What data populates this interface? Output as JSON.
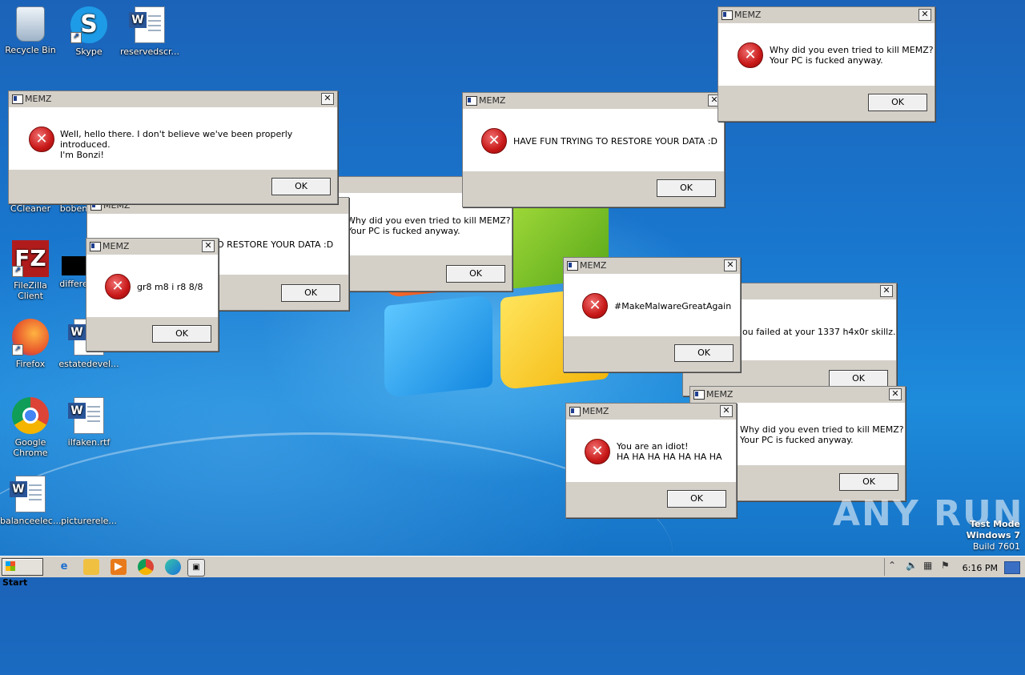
{
  "desktop_icons": [
    {
      "label": "Recycle Bin",
      "icon": "recycle-bin-icon"
    },
    {
      "label": "Skype",
      "icon": "skype-icon"
    },
    {
      "label": "reservedscr...",
      "icon": "word-document-icon"
    },
    {
      "label": "CCleaner",
      "icon": "ccleaner-icon"
    },
    {
      "label": "boben",
      "icon": "word-document-icon"
    },
    {
      "label": "FileZilla Client",
      "icon": "filezilla-icon"
    },
    {
      "label": "differe",
      "icon": "black-file-icon"
    },
    {
      "label": "Firefox",
      "icon": "firefox-icon"
    },
    {
      "label": "estatedevel...",
      "icon": "word-document-icon"
    },
    {
      "label": "Google Chrome",
      "icon": "chrome-icon"
    },
    {
      "label": "ilfaken.rtf",
      "icon": "word-document-icon"
    },
    {
      "label": "balanceelec...",
      "icon": "word-document-icon"
    },
    {
      "label": "picturerele...",
      "icon": "file-icon"
    }
  ],
  "dialogs": [
    {
      "title": "MEMZ",
      "message": "Why did you even tried to kill MEMZ?\nYour PC is fucked anyway.",
      "button": "OK"
    },
    {
      "title": "MEMZ",
      "message": "HAVE FUN TRYING TO RESTORE YOUR DATA :D",
      "button": "OK"
    },
    {
      "title": "MEMZ",
      "message": "Well, hello there. I don't believe we've been properly introduced.\nI'm Bonzi!",
      "button": "OK"
    },
    {
      "title": "",
      "message": "Why did you even tried to kill MEMZ?\nYour PC is fucked anyway.",
      "button": "OK"
    },
    {
      "title": "MEMZ",
      "message": "O RESTORE YOUR DATA :D",
      "button": "OK"
    },
    {
      "title": "MEMZ",
      "message": "gr8 m8 i r8 8/8",
      "button": "OK"
    },
    {
      "title": "MEMZ",
      "message": "#MakeMalwareGreatAgain",
      "button": "OK"
    },
    {
      "title": "",
      "message": "ou failed at your 1337 h4x0r skillz.",
      "button": "OK"
    },
    {
      "title": "MEMZ",
      "message": "Why did you even tried to kill MEMZ?\nYour PC is fucked anyway.",
      "button": "OK"
    },
    {
      "title": "MEMZ",
      "message": "You are an idiot!\nHA HA HA HA HA HA HA",
      "button": "OK"
    }
  ],
  "dialog_icon_glyph": "✕",
  "watermark": "ANY RUN",
  "test_mode": {
    "line1": "Test Mode",
    "line2": "Windows 7",
    "line3": "Build 7601"
  },
  "taskbar": {
    "start_label": "Start",
    "pinned": [
      "ie-icon",
      "explorer-icon",
      "media-player-icon",
      "chrome-icon",
      "edge-icon",
      "memz-taskbar-icon"
    ],
    "clock": "6:16 PM"
  }
}
